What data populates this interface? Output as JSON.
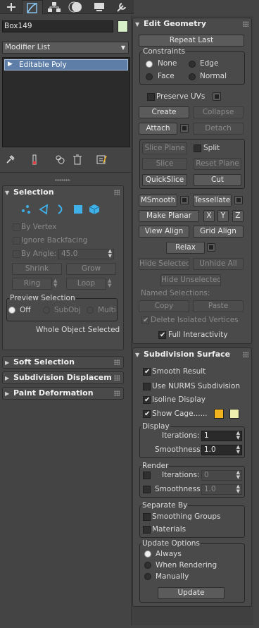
{
  "command_tabs": [
    {
      "name": "create-tab",
      "icon": "plus-icon"
    },
    {
      "name": "modify-tab",
      "icon": "modify-bend-icon"
    },
    {
      "name": "hierarchy-tab",
      "icon": "hierarchy-icon"
    },
    {
      "name": "motion-tab",
      "icon": "motion-icon"
    },
    {
      "name": "display-tab",
      "icon": "display-monitor-icon"
    },
    {
      "name": "utilities-tab",
      "icon": "wrench-icon"
    }
  ],
  "object_name": "Box149",
  "object_color": "#d8f0c8",
  "modifier_list": "Modifier List",
  "stack": {
    "items": [
      "Editable Poly"
    ]
  },
  "left": {
    "selection": {
      "title": "Selection",
      "by_vertex": "By Vertex",
      "ignore_backfacing": "Ignore Backfacing",
      "by_angle": "By Angle:",
      "angle_value": "45.0",
      "shrink": "Shrink",
      "grow": "Grow",
      "ring": "Ring",
      "loop": "Loop",
      "preview_title": "Preview Selection",
      "off": "Off",
      "subobj": "SubObj",
      "multi": "Multi",
      "status": "Whole Object Selected"
    },
    "rollouts": [
      "Soft Selection",
      "Subdivision Displacement",
      "Paint Deformation"
    ]
  },
  "right": {
    "edit_geometry": {
      "title": "Edit Geometry",
      "repeat_last": "Repeat Last",
      "constraints": "Constraints",
      "none": "None",
      "edge": "Edge",
      "face": "Face",
      "normal": "Normal",
      "preserve_uvs": "Preserve UVs",
      "create": "Create",
      "collapse": "Collapse",
      "attach": "Attach",
      "detach": "Detach",
      "slice_plane": "Slice Plane",
      "split": "Split",
      "slice": "Slice",
      "reset_plane": "Reset Plane",
      "quickslice": "QuickSlice",
      "cut": "Cut",
      "msmooth": "MSmooth",
      "tessellate": "Tessellate",
      "make_planar": "Make Planar",
      "x": "X",
      "y": "Y",
      "z": "Z",
      "view_align": "View Align",
      "grid_align": "Grid Align",
      "relax": "Relax",
      "hide_selected": "Hide Selected",
      "unhide_all": "Unhide All",
      "hide_unselected": "Hide Unselected",
      "named_selections": "Named Selections:",
      "copy": "Copy",
      "paste": "Paste",
      "delete_isolated": "Delete Isolated Vertices",
      "full_interactivity": "Full Interactivity"
    },
    "subdivision": {
      "title": "Subdivision Surface",
      "smooth_result": "Smooth Result",
      "use_nurms": "Use NURMS Subdivision",
      "isoline_display": "Isoline Display",
      "show_cage": "Show Cage......",
      "cage_color_1": "#f2b41e",
      "cage_color_2": "#eef0b0",
      "display": "Display",
      "iterations": "Iterations:",
      "iterations_value": "1",
      "smoothness": "Smoothness:",
      "smoothness_value": "1.0",
      "render": "Render",
      "render_iterations": "Iterations:",
      "render_iterations_value": "0",
      "render_smoothness": "Smoothness:",
      "render_smoothness_value": "1.0",
      "separate_by": "Separate By",
      "smoothing_groups": "Smoothing Groups",
      "materials": "Materials",
      "update_options": "Update Options",
      "always": "Always",
      "when_rendering": "When Rendering",
      "manually": "Manually",
      "update": "Update"
    }
  }
}
